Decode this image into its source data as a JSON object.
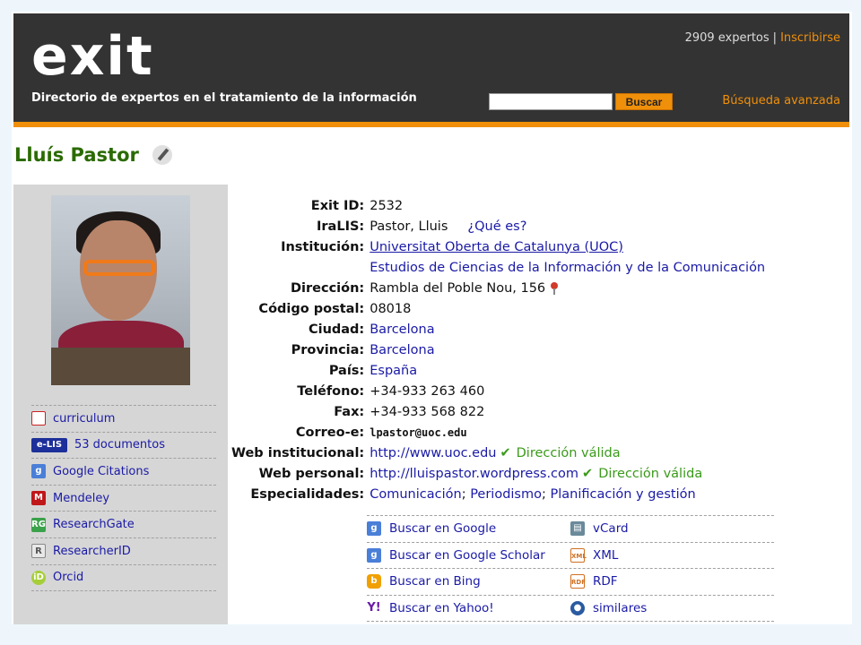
{
  "header": {
    "logo": "exit",
    "tagline": "Directorio de expertos en el tratamiento de la información",
    "experts_count": "2909 expertos",
    "separator": "|",
    "register_label": "Inscribirse",
    "search_placeholder": "",
    "search_button": "Buscar",
    "advanced_search": "Búsqueda avanzada",
    "accent_color": "#f0900a",
    "bg_color": "#333333"
  },
  "profile": {
    "name": "Lluís Pastor",
    "edit_icon": "pencil-icon"
  },
  "sidebar": {
    "items": [
      {
        "icon": "pdf-icon",
        "glyph": "",
        "label": "curriculum"
      },
      {
        "icon": "elis-icon",
        "glyph": "e-LIS",
        "label": "53 documentos"
      },
      {
        "icon": "google-icon",
        "glyph": "g",
        "label": "Google Citations"
      },
      {
        "icon": "mendeley-icon",
        "glyph": "M",
        "label": "Mendeley"
      },
      {
        "icon": "researchgate-icon",
        "glyph": "RG",
        "label": "ResearchGate"
      },
      {
        "icon": "researcherid-icon",
        "glyph": "R",
        "label": "ResearcherID"
      },
      {
        "icon": "orcid-icon",
        "glyph": "iD",
        "label": "Orcid"
      }
    ]
  },
  "info": {
    "exit_id": {
      "label": "Exit ID:",
      "value": "2532"
    },
    "iralis": {
      "label": "IraLIS:",
      "value": "Pastor, Lluis",
      "link": "¿Qué es?"
    },
    "institucion": {
      "label": "Institución:",
      "value": "Universitat Oberta de Catalunya (UOC)",
      "sub": "Estudios de Ciencias de la Información y de la Comunicación"
    },
    "direccion": {
      "label": "Dirección:",
      "value": "Rambla del Poble Nou, 156"
    },
    "codigo_postal": {
      "label": "Código postal:",
      "value": "08018"
    },
    "ciudad": {
      "label": "Ciudad:",
      "value": "Barcelona"
    },
    "provincia": {
      "label": "Provincia:",
      "value": "Barcelona"
    },
    "pais": {
      "label": "País:",
      "value": "España"
    },
    "telefono": {
      "label": "Teléfono:",
      "value": "+34-933 263 460"
    },
    "fax": {
      "label": "Fax:",
      "value": "+34-933 568 822"
    },
    "correo": {
      "label": "Correo-e:",
      "value": "lpastor@uoc.edu"
    },
    "web_inst": {
      "label": "Web institucional:",
      "value": "http://www.uoc.edu",
      "status": "Dirección válida"
    },
    "web_pers": {
      "label": "Web personal:",
      "value": "http://lluispastor.wordpress.com",
      "status": "Dirección válida"
    },
    "especialidades": {
      "label": "Especialidades:",
      "items": [
        "Comunicación",
        "Periodismo",
        "Planificación y gestión"
      ],
      "sep": ";"
    }
  },
  "search_links": {
    "rows": [
      {
        "left": {
          "icon": "google-icon",
          "glyph": "g",
          "label": "Buscar en Google"
        },
        "right": {
          "icon": "vcard-icon",
          "glyph": "▤",
          "label": "vCard"
        }
      },
      {
        "left": {
          "icon": "google-icon",
          "glyph": "g",
          "label": "Buscar en Google Scholar"
        },
        "right": {
          "icon": "xml-icon",
          "glyph": "XML",
          "label": "XML"
        }
      },
      {
        "left": {
          "icon": "bing-icon",
          "glyph": "b",
          "label": "Buscar en Bing"
        },
        "right": {
          "icon": "rdf-icon",
          "glyph": "RDF",
          "label": "RDF"
        }
      },
      {
        "left": {
          "icon": "yahoo-icon",
          "glyph": "Y!",
          "label": "Buscar en Yahoo!"
        },
        "right": {
          "icon": "similar-icon",
          "glyph": "●",
          "label": "similares"
        }
      }
    ]
  }
}
